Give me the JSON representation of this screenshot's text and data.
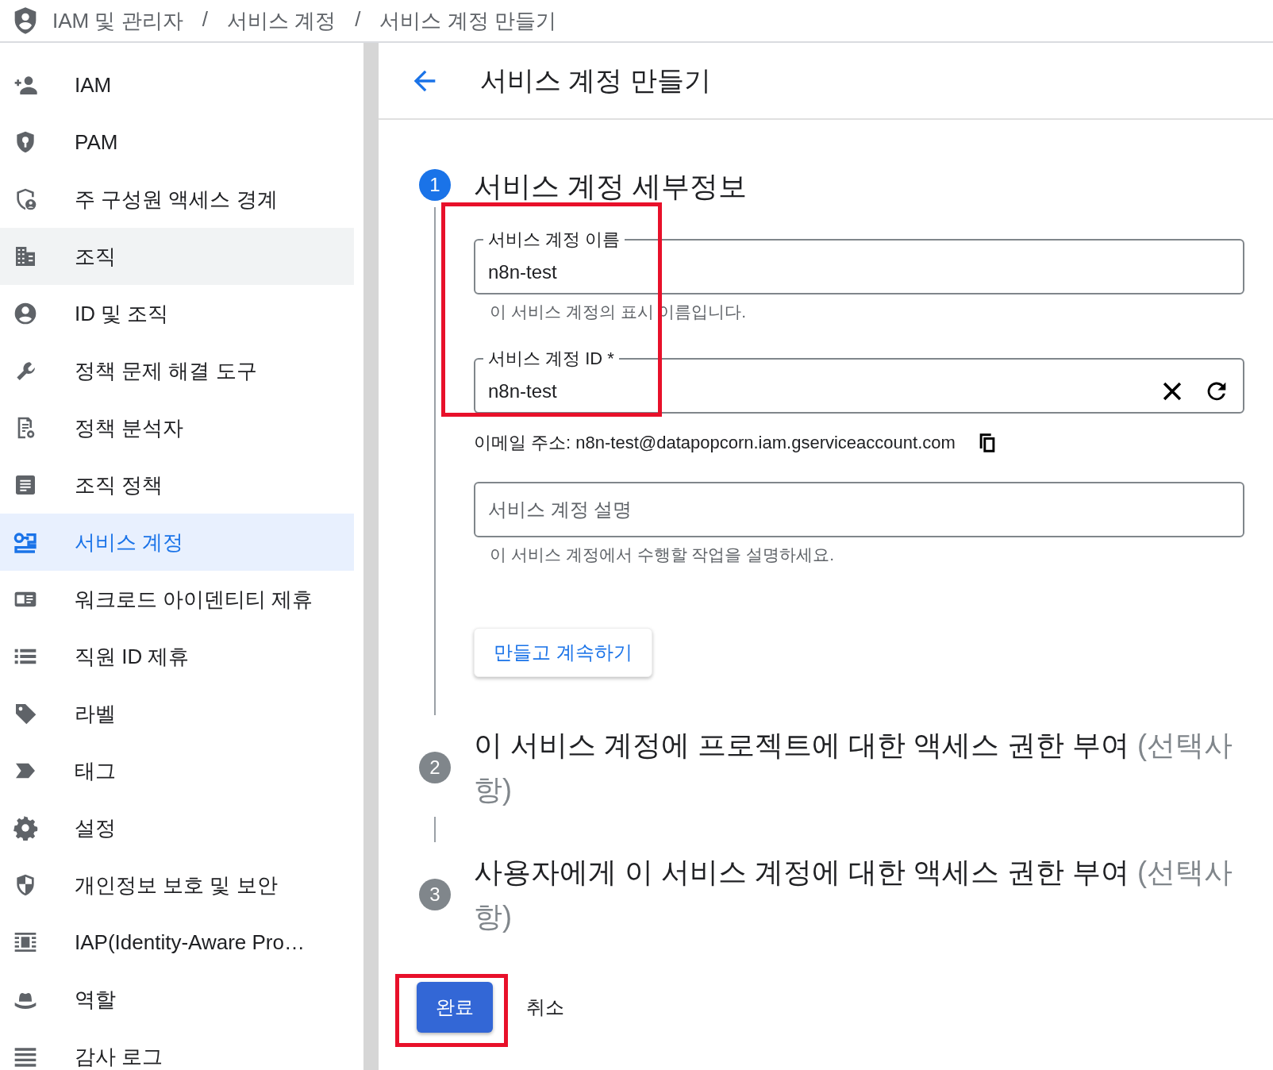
{
  "breadcrumb": [
    {
      "label": "IAM 및 관리자"
    },
    {
      "separator": "/",
      "label": "서비스 계정"
    },
    {
      "separator": "/",
      "label": "서비스 계정 만들기"
    }
  ],
  "sidebar": {
    "items": [
      {
        "label": "IAM",
        "selected": false,
        "hovered": false
      },
      {
        "label": "PAM",
        "selected": false,
        "hovered": false
      },
      {
        "label": "주 구성원 액세스 경계",
        "selected": false,
        "hovered": false
      },
      {
        "label": "조직",
        "selected": false,
        "hovered": true
      },
      {
        "label": "ID 및 조직",
        "selected": false,
        "hovered": false
      },
      {
        "label": "정책 문제 해결 도구",
        "selected": false,
        "hovered": false
      },
      {
        "label": "정책 분석자",
        "selected": false,
        "hovered": false
      },
      {
        "label": "조직 정책",
        "selected": false,
        "hovered": false
      },
      {
        "label": "서비스 계정",
        "selected": true,
        "hovered": false
      },
      {
        "label": "워크로드 아이덴티티 제휴",
        "selected": false,
        "hovered": false
      },
      {
        "label": "직원 ID 제휴",
        "selected": false,
        "hovered": false
      },
      {
        "label": "라벨",
        "selected": false,
        "hovered": false
      },
      {
        "label": "태그",
        "selected": false,
        "hovered": false
      },
      {
        "label": "설정",
        "selected": false,
        "hovered": false
      },
      {
        "label": "개인정보 보호 및 보안",
        "selected": false,
        "hovered": false
      },
      {
        "label": "IAP(Identity-Aware Pro…",
        "selected": false,
        "hovered": false
      },
      {
        "label": "역할",
        "selected": false,
        "hovered": false
      },
      {
        "label": "감사 로그",
        "selected": false,
        "hovered": false
      }
    ]
  },
  "page": {
    "title": "서비스 계정 만들기"
  },
  "steps": [
    {
      "number": "1",
      "title": "서비스 계정 세부정보",
      "active": true
    },
    {
      "number": "2",
      "title": "이 서비스 계정에 프로젝트에 대한 액세스 권한 부여",
      "optional": "(선택사항)",
      "active": false
    },
    {
      "number": "3",
      "title": "사용자에게 이 서비스 계정에 대한 액세스 권한 부여",
      "optional": "(선택사항)",
      "active": false
    }
  ],
  "form": {
    "highlighted": true,
    "name_field": {
      "label": "서비스 계정 이름",
      "value": "n8n-test",
      "helper": "이 서비스 계정의 표시 이름입니다."
    },
    "id_field": {
      "label": "서비스 계정 ID *",
      "value": "n8n-test"
    },
    "email": "이메일 주소: n8n-test@datapopcorn.iam.gserviceaccount.com",
    "description_field": {
      "placeholder": "서비스 계정 설명",
      "helper": "이 서비스 계정에서 수행할 작업을 설명하세요."
    },
    "continue_button": "만들고 계속하기"
  },
  "actions": {
    "done": {
      "label": "완료",
      "highlighted": true
    },
    "cancel": {
      "label": "취소"
    }
  }
}
